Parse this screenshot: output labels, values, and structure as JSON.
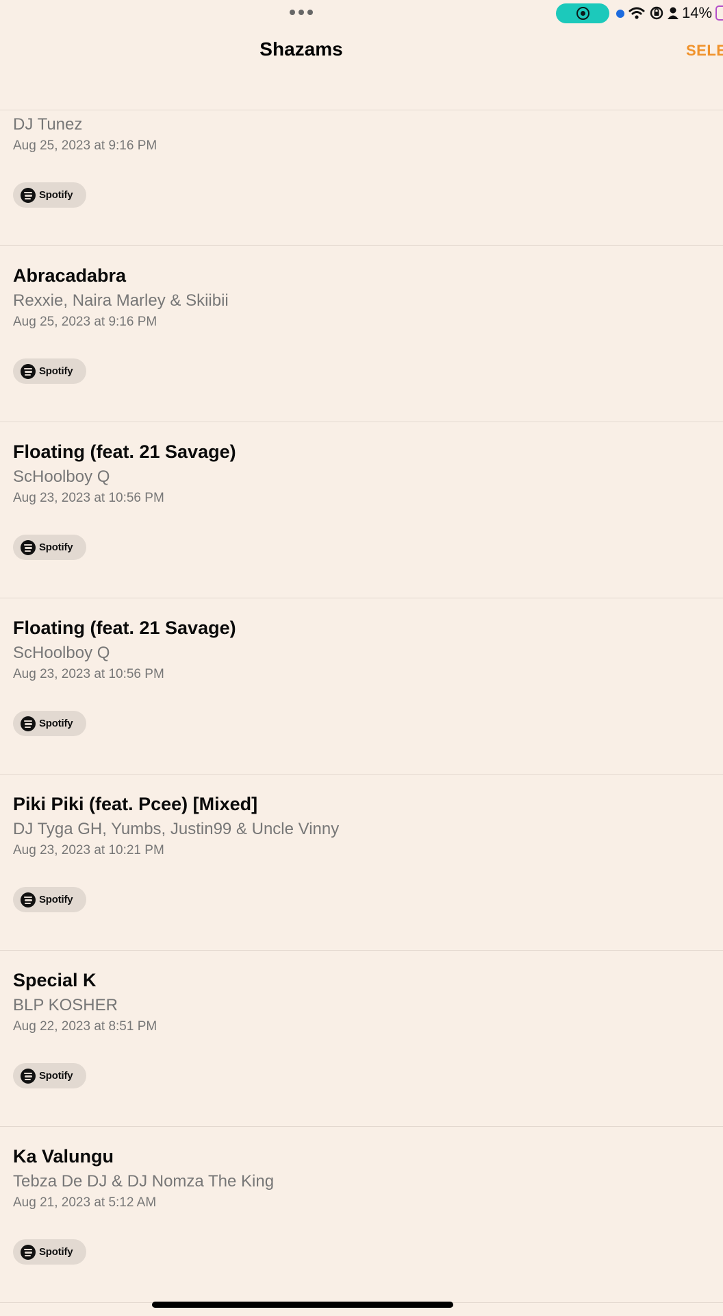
{
  "status_bar": {
    "battery_percent": "14%",
    "colors": {
      "record_pill": "#1cc9bb",
      "location_dot": "#1d6bde",
      "battery": "#b44fc9"
    }
  },
  "nav": {
    "title": "Shazams",
    "select_label": "SELE",
    "accent_color": "#f0922b"
  },
  "spotify_label": "Spotify",
  "items": [
    {
      "title": "",
      "artist": "DJ Tunez",
      "date": "Aug 25, 2023 at 9:16 PM"
    },
    {
      "title": "Abracadabra",
      "artist": "Rexxie, Naira Marley & Skiibii",
      "date": "Aug 25, 2023 at 9:16 PM"
    },
    {
      "title": "Floating (feat. 21 Savage)",
      "artist": "ScHoolboy Q",
      "date": "Aug 23, 2023 at 10:56 PM"
    },
    {
      "title": "Floating (feat. 21 Savage)",
      "artist": "ScHoolboy Q",
      "date": "Aug 23, 2023 at 10:56 PM"
    },
    {
      "title": "Piki Piki (feat. Pcee) [Mixed]",
      "artist": "DJ Tyga GH, Yumbs, Justin99 & Uncle Vinny",
      "date": "Aug 23, 2023 at 10:21 PM"
    },
    {
      "title": "Special K",
      "artist": "BLP KOSHER",
      "date": "Aug 22, 2023 at 8:51 PM"
    },
    {
      "title": "Ka Valungu",
      "artist": "Tebza De DJ & DJ Nomza The King",
      "date": "Aug 21, 2023 at 5:12 AM"
    }
  ]
}
